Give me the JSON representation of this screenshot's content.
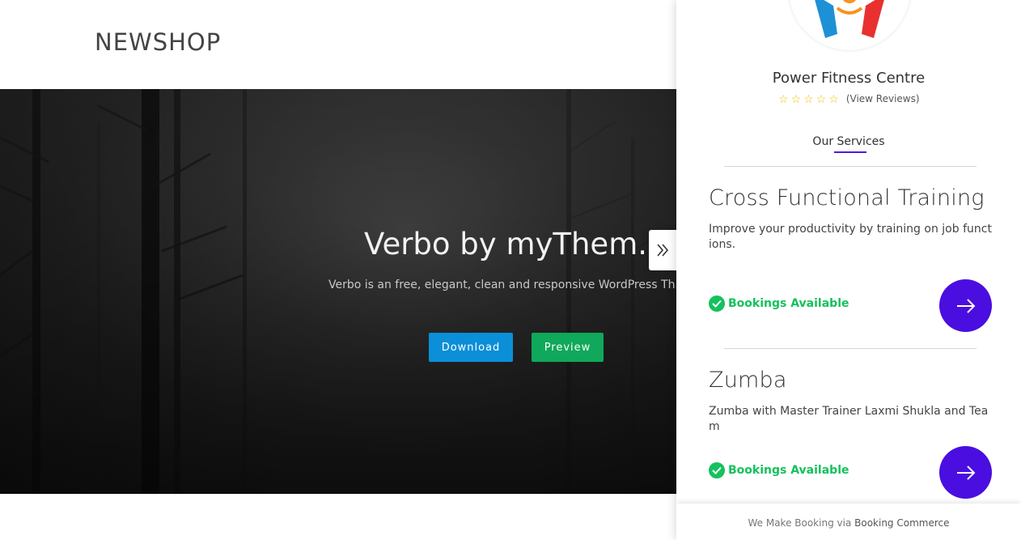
{
  "site": {
    "logo": "NEWSHOP",
    "hero": {
      "title": "Verbo by myThem.e",
      "subtitle": "Verbo is an free, elegant, clean and responsive WordPress Th",
      "download_label": "Download",
      "preview_label": "Preview"
    }
  },
  "panel": {
    "toggle_icon": "double-chevron-right-icon",
    "business_name": "Power Fitness Centre",
    "rating": {
      "stars_filled": 0,
      "stars_total": 5,
      "reviews_label": "(View Reviews)"
    },
    "tab_label": "Our Services",
    "services": [
      {
        "title": "Cross Functional Training",
        "description": "Improve your productivity by training on job functions.",
        "status": "Bookings Available"
      },
      {
        "title": "Zumba",
        "description": "Zumba with Master Trainer Laxmi Shukla and Team",
        "status": "Bookings Available"
      }
    ],
    "footer": {
      "prefix": "We Make Booking via",
      "brand": "Booking Commerce"
    }
  },
  "colors": {
    "accent": "#4a0ee0",
    "status_green": "#15c15d",
    "download_blue": "#0b8fd8",
    "preview_green": "#10a85a",
    "star_yellow": "#f0c20a"
  }
}
